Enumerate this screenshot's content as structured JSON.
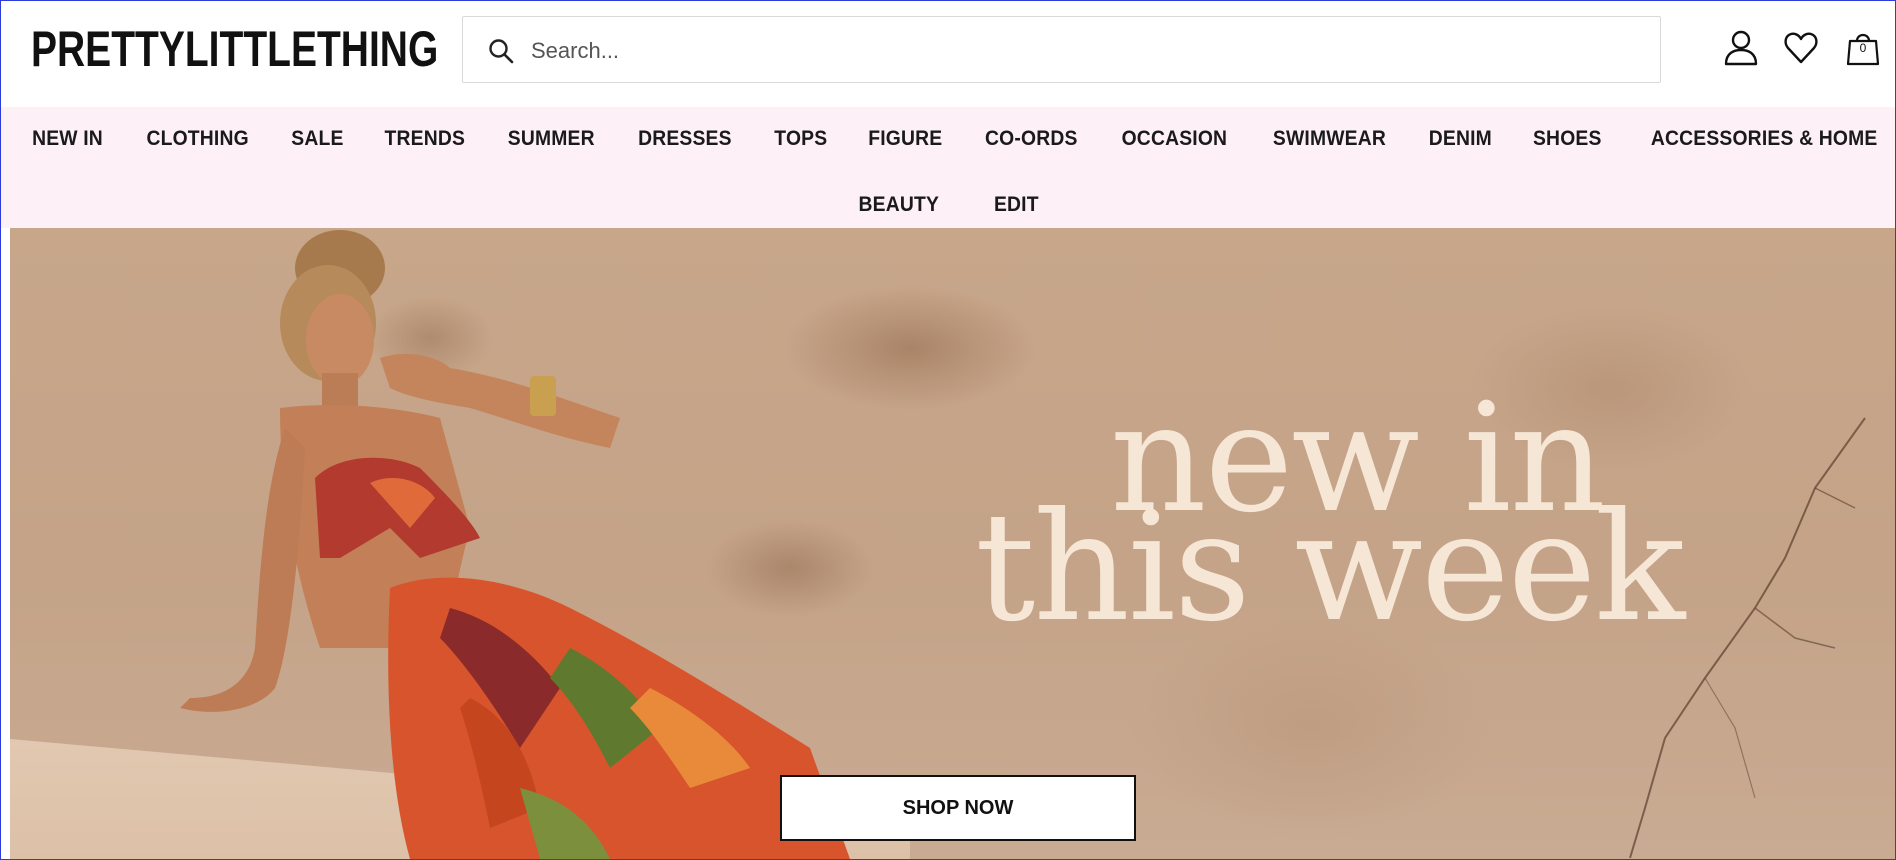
{
  "header": {
    "logo_text": "PRETTYLITTLETHING",
    "search_placeholder": "Search...",
    "bag_count": "0"
  },
  "nav": {
    "row1": [
      "NEW IN",
      "CLOTHING",
      "SALE",
      "TRENDS",
      "SUMMER",
      "DRESSES",
      "TOPS",
      "FIGURE",
      "CO-ORDS",
      "OCCASION",
      "SWIMWEAR",
      "DENIM",
      "SHOES",
      "ACCESSORIES & HOME"
    ],
    "row2": [
      "BEAUTY",
      "EDIT"
    ]
  },
  "hero": {
    "title_line1": "new in",
    "title_line2": "this week",
    "cta_label": "SHOP NOW"
  },
  "colors": {
    "nav_background": "#fdf0f6",
    "hero_text": "#f6e6d6",
    "frame_border": "#2b3be0"
  }
}
